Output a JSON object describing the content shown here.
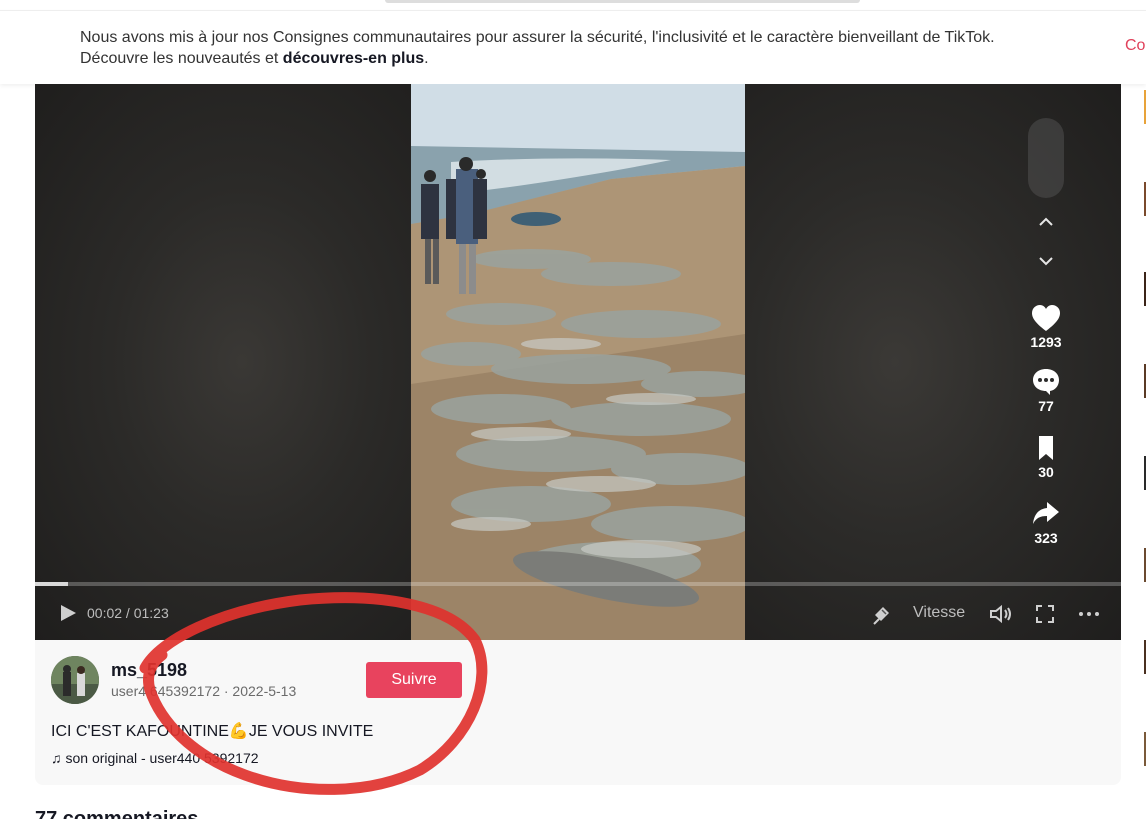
{
  "banner": {
    "line1": "Nous avons mis à jour nos Consignes communautaires pour assurer la sécurité, l'inclusivité et le caractère bienveillant de TikTok.",
    "line2_prefix": "Découvre les nouveautés et ",
    "line2_link": "découvres-en plus",
    "line2_suffix": ".",
    "action": "Co"
  },
  "player": {
    "time": "00:02 / 01:23",
    "progress": 0.03,
    "speed_label": "Vitesse"
  },
  "actions": {
    "likes": "1293",
    "comments": "77",
    "saves": "30",
    "shares": "323"
  },
  "author": {
    "username": "ms_5198",
    "userline": "user4 645392172 · 2022-5-13",
    "follow_label": "Suivre"
  },
  "caption": "ICI C'EST KAFOUNTINE💪JE VOUS INVITE",
  "music": "son original - user440 5392172",
  "comments_heading": "77 commentaires",
  "icons": [
    "chevron-up-icon",
    "chevron-down-icon",
    "heart-icon",
    "comment-icon",
    "bookmark-icon",
    "share-icon",
    "play-icon",
    "floating-player-icon",
    "volume-icon",
    "fullscreen-icon",
    "more-icon",
    "music-note-icon"
  ],
  "colors": {
    "accent": "#e8435e",
    "annotation": "#e0322e"
  }
}
